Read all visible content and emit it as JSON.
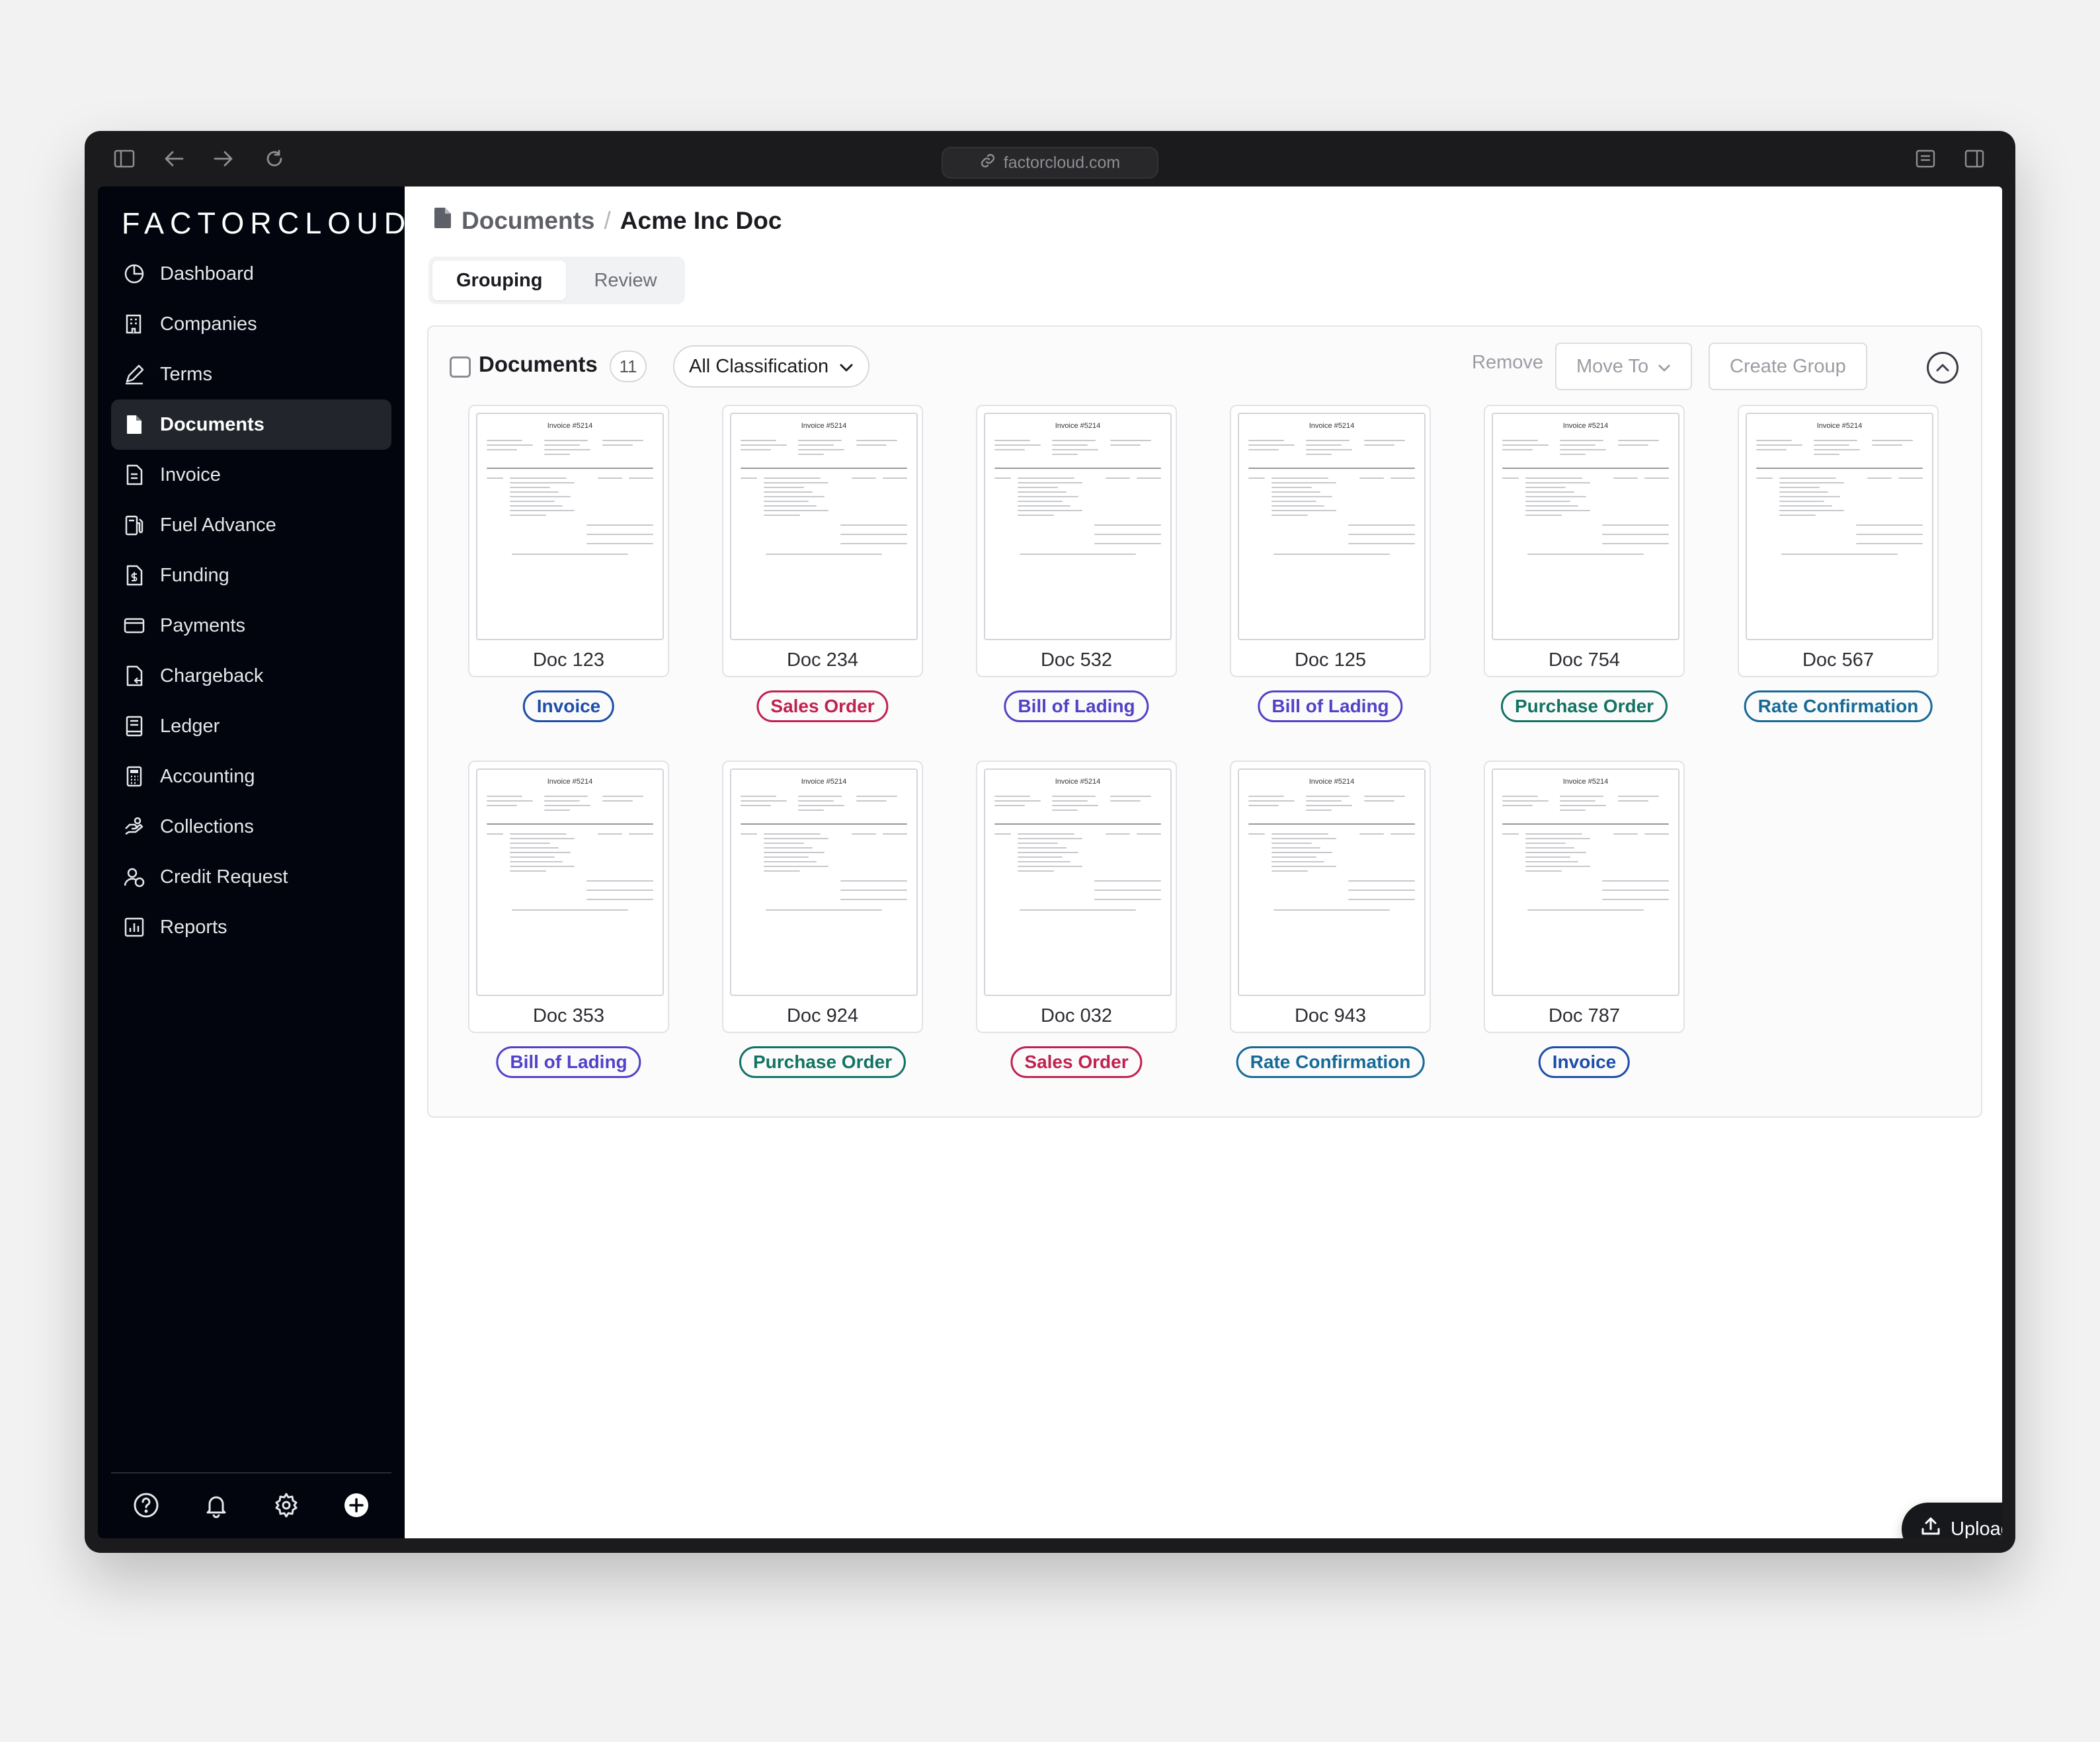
{
  "browser": {
    "url": "factorcloud.com"
  },
  "brand": "FACTORCLOUD",
  "nav": [
    {
      "label": "Dashboard",
      "icon": "dashboard-icon"
    },
    {
      "label": "Companies",
      "icon": "building-icon"
    },
    {
      "label": "Terms",
      "icon": "pen-icon"
    },
    {
      "label": "Documents",
      "icon": "document-icon",
      "active": true
    },
    {
      "label": "Invoice",
      "icon": "invoice-icon"
    },
    {
      "label": "Fuel Advance",
      "icon": "fuel-icon"
    },
    {
      "label": "Funding",
      "icon": "funding-icon"
    },
    {
      "label": "Payments",
      "icon": "card-icon"
    },
    {
      "label": "Chargeback",
      "icon": "chargeback-icon"
    },
    {
      "label": "Ledger",
      "icon": "ledger-icon"
    },
    {
      "label": "Accounting",
      "icon": "calculator-icon"
    },
    {
      "label": "Collections",
      "icon": "collections-icon"
    },
    {
      "label": "Credit Request",
      "icon": "credit-request-icon"
    },
    {
      "label": "Reports",
      "icon": "reports-icon"
    }
  ],
  "footer_icons": [
    "help-icon",
    "bell-icon",
    "gear-icon",
    "plus-circle-icon"
  ],
  "breadcrumb": {
    "parent": "Documents",
    "separator": "/",
    "current": "Acme Inc Doc"
  },
  "tabs": [
    {
      "label": "Grouping",
      "active": true
    },
    {
      "label": "Review",
      "active": false
    }
  ],
  "toolbar": {
    "title": "Documents",
    "count": "11",
    "filter": "All Classification",
    "remove": "Remove",
    "move_to": "Move To",
    "create_group": "Create Group"
  },
  "thumbnail_text": "Invoice #5214",
  "classification_colors": {
    "Invoice": "#1d4ea8",
    "Sales Order": "#c0224f",
    "Bill of Lading": "#5142c7",
    "Purchase Order": "#137363",
    "Rate Confirmation": "#166a96"
  },
  "documents": [
    {
      "name": "Doc 123",
      "type": "Invoice"
    },
    {
      "name": "Doc 234",
      "type": "Sales Order"
    },
    {
      "name": "Doc 532",
      "type": "Bill of Lading"
    },
    {
      "name": "Doc 125",
      "type": "Bill of Lading"
    },
    {
      "name": "Doc 754",
      "type": "Purchase Order"
    },
    {
      "name": "Doc 567",
      "type": "Rate Confirmation"
    },
    {
      "name": "Doc 353",
      "type": "Bill of Lading"
    },
    {
      "name": "Doc 924",
      "type": "Purchase Order"
    },
    {
      "name": "Doc 032",
      "type": "Sales Order"
    },
    {
      "name": "Doc 943",
      "type": "Rate Confirmation"
    },
    {
      "name": "Doc 787",
      "type": "Invoice"
    }
  ],
  "upload": "Upload"
}
